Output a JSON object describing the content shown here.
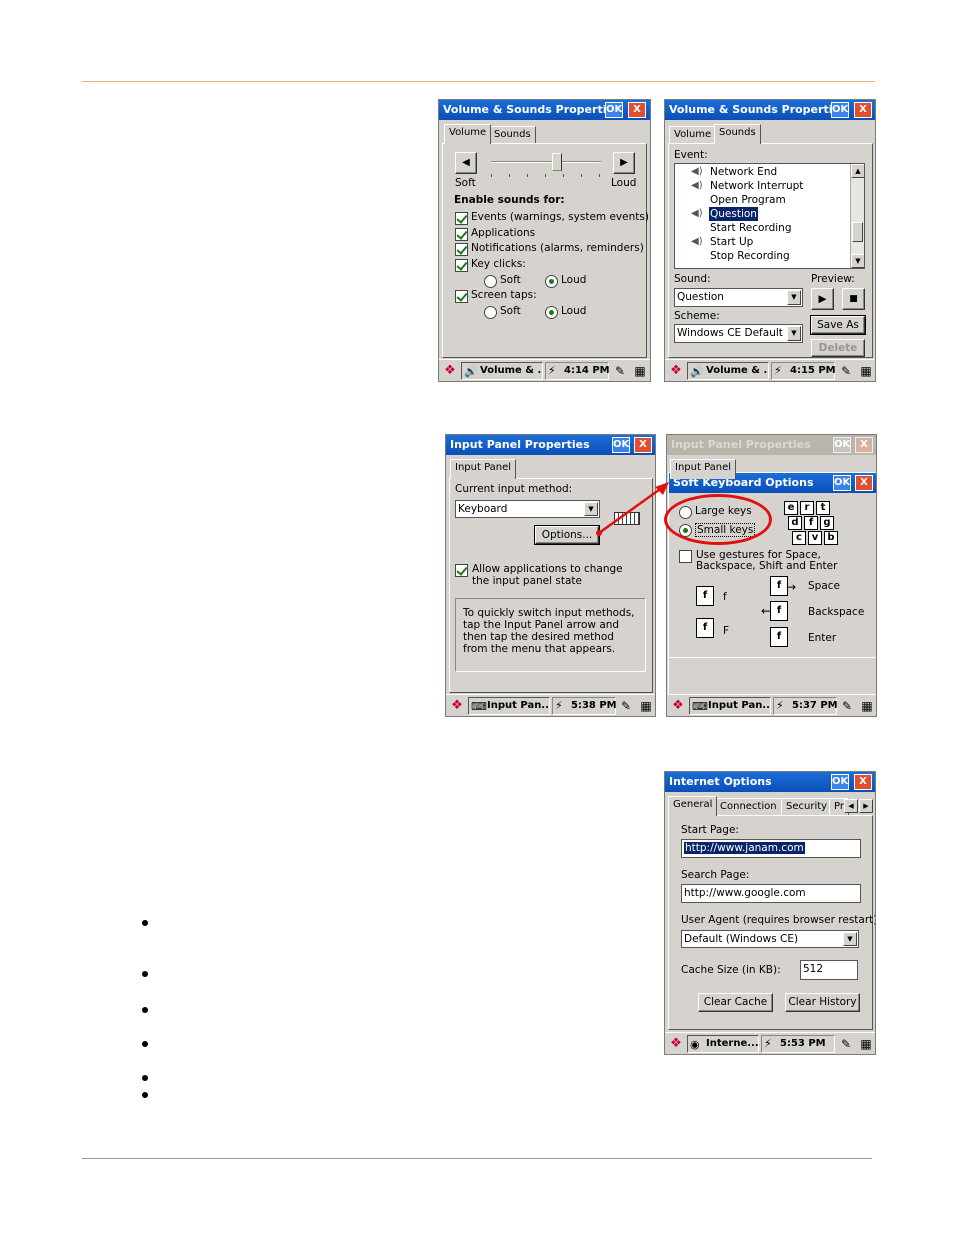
{
  "win1": {
    "title": "Volume & Sounds Properties",
    "ok": "OK",
    "close": "X",
    "tabs": [
      "Volume",
      "Sounds"
    ],
    "soft": "Soft",
    "loud": "Loud",
    "enable_label": "Enable sounds for:",
    "checks": [
      "Events (warnings, system events)",
      "Applications",
      "Notifications (alarms, reminders)",
      "Key clicks:",
      "Screen taps:"
    ],
    "radio_soft": "Soft",
    "radio_loud": "Loud",
    "volume_level": 0.6,
    "taskbar": {
      "task": "Volume & ...",
      "time": "4:14 PM"
    }
  },
  "win2": {
    "title": "Volume & Sounds Properties",
    "ok": "OK",
    "close": "X",
    "tabs": [
      "Volume",
      "Sounds"
    ],
    "event_label": "Event:",
    "events": [
      "Network End",
      "Network Interrupt",
      "Open Program",
      "Question",
      "Start Recording",
      "Start Up",
      "Stop Recording"
    ],
    "sound_label": "Sound:",
    "sound_value": "Question",
    "preview_label": "Preview:",
    "scheme_label": "Scheme:",
    "scheme_value": "Windows CE Default",
    "save_as": "Save As",
    "delete": "Delete",
    "taskbar": {
      "task": "Volume & ...",
      "time": "4:15 PM"
    }
  },
  "win3": {
    "title": "Input Panel Properties",
    "ok": "OK",
    "close": "X",
    "tab": "Input Panel",
    "method_label": "Current input method:",
    "method_value": "Keyboard",
    "options": "Options...",
    "allow": "Allow applications to change the input panel state",
    "hint": "To quickly switch input methods, tap the Input Panel arrow and then tap the desired method from the menu that appears.",
    "taskbar": {
      "task": "Input Pan...",
      "time": "5:38 PM"
    }
  },
  "win4": {
    "title_bg": "Input Panel Properties",
    "tab_bg": "Input Panel",
    "title": "Soft Keyboard Options",
    "ok": "OK",
    "close": "X",
    "large_keys": "Large keys",
    "small_keys": "Small keys",
    "keys": [
      "e",
      "r",
      "t",
      "d",
      "f",
      "g",
      "c",
      "v",
      "b"
    ],
    "gestures": "Use gestures for Space, Backspace, Shift and Enter",
    "g_f1": "f",
    "g_f2": "F",
    "g_space": "Space",
    "g_back": "Backspace",
    "g_enter": "Enter",
    "taskbar": {
      "task": "Input Pan...",
      "time": "5:37 PM"
    }
  },
  "win5": {
    "title": "Internet Options",
    "ok": "OK",
    "close": "X",
    "tabs": [
      "General",
      "Connection",
      "Security",
      "Pri"
    ],
    "start_label": "Start Page:",
    "start_value": "http://www.janam.com",
    "search_label": "Search Page:",
    "search_value": "http://www.google.com",
    "agent_label": "User Agent (requires browser restart):",
    "agent_value": "Default (Windows CE)",
    "cache_label": "Cache Size (in KB):",
    "cache_value": "512",
    "clear_cache": "Clear Cache",
    "clear_history": "Clear History",
    "taskbar": {
      "task": "Interne...",
      "time": "5:53 PM"
    }
  }
}
